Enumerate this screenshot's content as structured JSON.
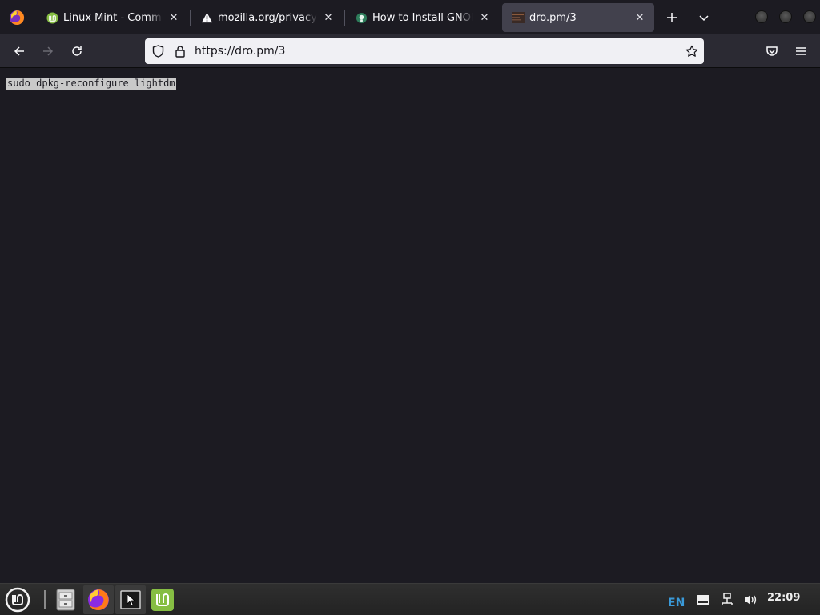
{
  "browser": {
    "tabs": [
      {
        "title": "Linux Mint - Communi",
        "favicon": "linux-mint-icon"
      },
      {
        "title": "mozilla.org/privacy/fi",
        "favicon": "warning-icon"
      },
      {
        "title": "How to Install GNOME",
        "favicon": "site-icon"
      },
      {
        "title": "dro.pm/3",
        "favicon": "site-icon"
      }
    ],
    "active_tab": 3,
    "url": "https://dro.pm/3",
    "accent": "#42414d"
  },
  "page": {
    "command": "sudo dpkg-reconfigure lightdm"
  },
  "taskbar": {
    "items": [
      "menu-icon",
      "file-manager-icon",
      "firefox-icon",
      "terminal-icon",
      "linux-mint-icon"
    ],
    "language": "EN",
    "clock": "22:09"
  }
}
